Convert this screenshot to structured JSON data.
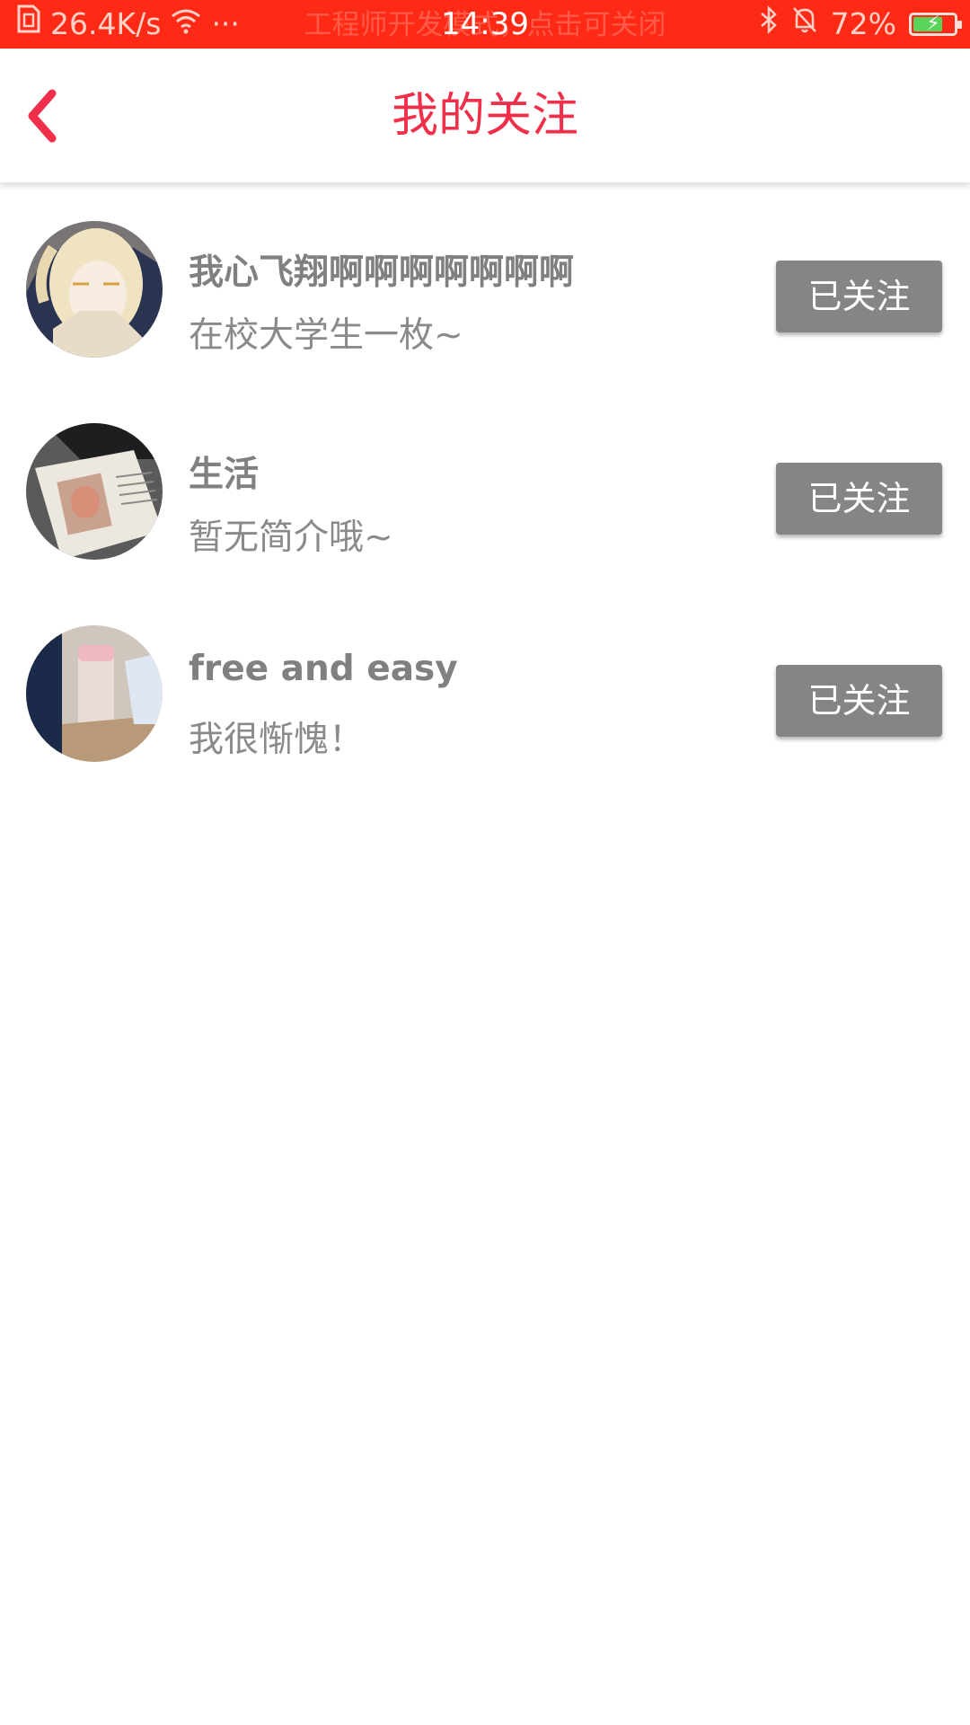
{
  "status_bar": {
    "net_speed": "26.4K/s",
    "more": "···",
    "notice": "工程师开发模式，点击可关闭",
    "time": "14:39",
    "battery": "72%",
    "battery_level": 0.72
  },
  "header": {
    "title": "我的关注"
  },
  "follows": [
    {
      "name": "我心飞翔啊啊啊啊啊啊啊",
      "bio": "在校大学生一枚~",
      "button": "已关注"
    },
    {
      "name": "生活",
      "bio": "暂无简介哦~",
      "button": "已关注"
    },
    {
      "name": "free and easy",
      "bio": "我很惭愧！",
      "button": "已关注"
    }
  ],
  "colors": {
    "status_bar": "#ff2a16",
    "accent": "#f0304a",
    "button": "#858585"
  }
}
